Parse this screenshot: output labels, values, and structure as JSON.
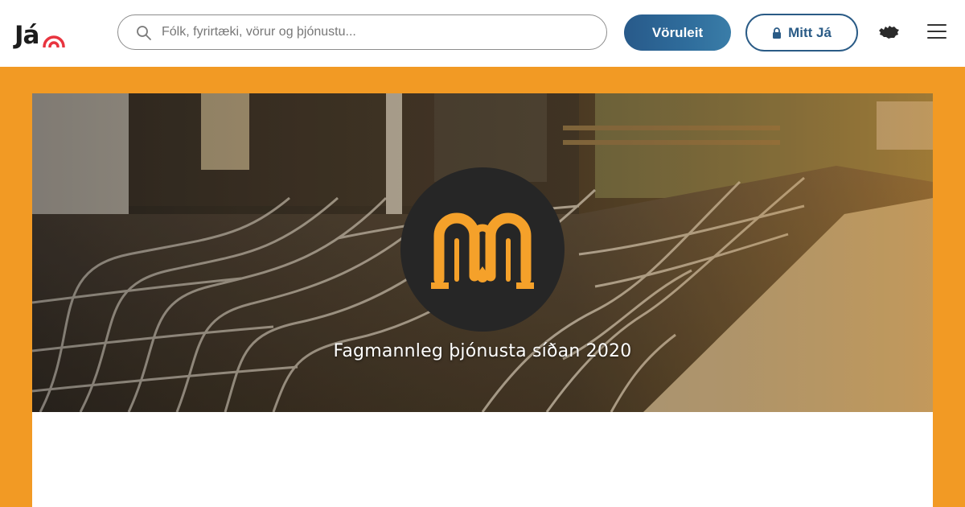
{
  "header": {
    "logo_text": "Já",
    "search": {
      "placeholder": "Fólk, fyrirtæki, vörur og þjónustu..."
    },
    "voruleit_label": "Vöruleit",
    "mittja_label": "Mitt Já"
  },
  "cover": {
    "tagline": "Fagmannleg þjónusta síðan 2020"
  },
  "colors": {
    "page_background": "#f29a24",
    "brand_blue": "#2a5b86",
    "logo_accent": "#e8343f",
    "brand_orange": "#f5a12a",
    "brand_dark": "#262626"
  },
  "icons": [
    "ja-signal-icon",
    "search-icon",
    "lock-icon",
    "iceland-icon",
    "menu-icon",
    "brand-logo"
  ]
}
